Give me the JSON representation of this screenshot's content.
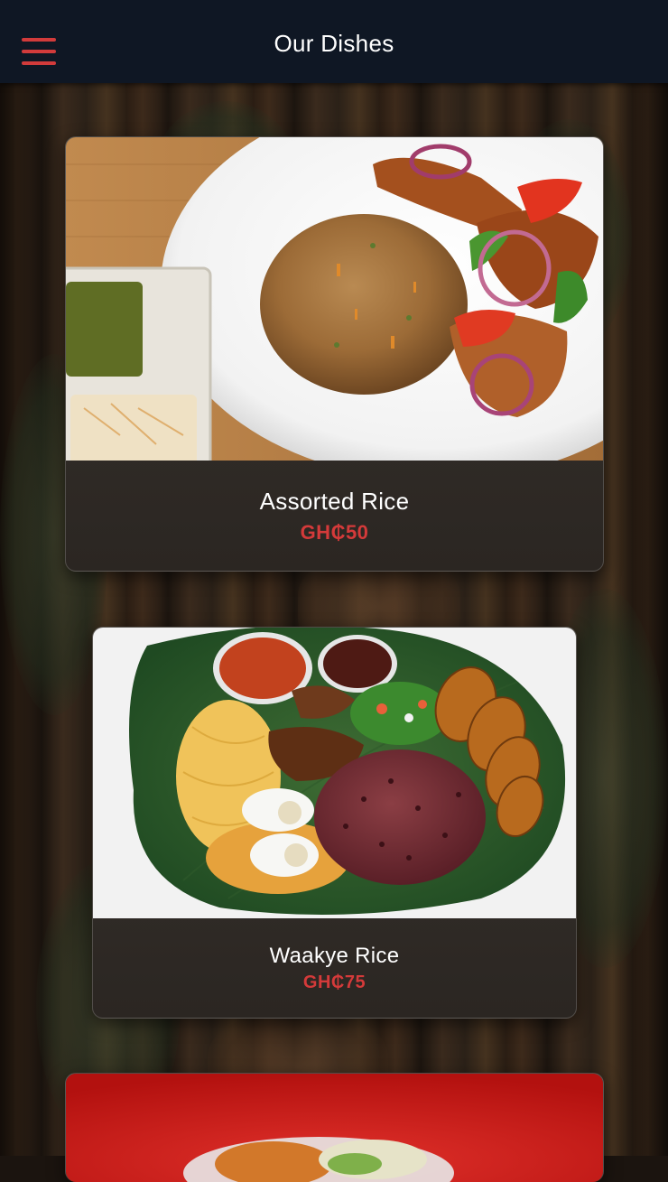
{
  "header": {
    "title": "Our Dishes",
    "menu_icon": "hamburger-menu-icon",
    "accent_color": "#d23b3b",
    "background_color": "#0f1724"
  },
  "dishes": [
    {
      "name": "Assorted Rice",
      "price": "GH₵50"
    },
    {
      "name": "Waakye Rice",
      "price": "GH₵75"
    }
  ],
  "price_color": "#d43a3a"
}
